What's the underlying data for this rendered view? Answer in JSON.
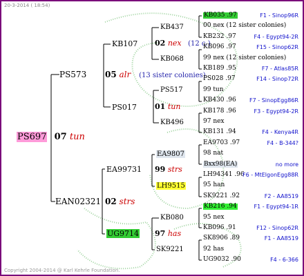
{
  "header": {
    "timestamp": "20-3-2014 ( 18:54)"
  },
  "footer": {
    "copyright": "Copyright 2004-2014 @ Karl Kehrle Foundation."
  },
  "root": {
    "id": "PS697",
    "mark": "07",
    "tag": "tun"
  },
  "g1": [
    {
      "id": "PS573"
    },
    {
      "id": "EAN02321",
      "mark": "02",
      "tag": "strs"
    }
  ],
  "g1_marks": {
    "ps573": {
      "mark": "05",
      "tag": "alr",
      "note": "(13 sister colonies)"
    }
  },
  "g2": {
    "kb107": "KB107",
    "ps017": "PS017",
    "ea99731": "EA99731",
    "ug9714": "UG9714",
    "ps017_mark": "01",
    "ps017_tag": "tun",
    "ea99731_mark": "99",
    "ea99731_tag": "strs",
    "ug9714_mark": "97",
    "ug9714_tag": "has",
    "kb107_mark": "02",
    "kb107_tag": "nex",
    "kb107_note": "(12 c.)"
  },
  "g3": {
    "kb437": "KB437",
    "kb068": "KB068",
    "ps517": "PS517",
    "kb496": "KB496",
    "ea9807": "EA9807",
    "lh9515": "LH9515",
    "kb080": "KB080",
    "sk9221": "SK9221",
    "ps517_mark": "99",
    "ps517_tag": "tun",
    "kb496_mark": "97",
    "kb496_tag": "nex",
    "ea9807_mark": "98",
    "ea9807_tag": "nat",
    "lh9515_mark": "95",
    "lh9515_tag": "han",
    "kb080_mark": "95",
    "kb080_tag": "nex",
    "sk9221_mark": "92",
    "sk9221_tag": "has"
  },
  "g4": [
    {
      "left": "KB035 .97",
      "right": "F1 - Sinop96R"
    },
    {
      "left": "00 nex (12 sister colonies)",
      "right": ""
    },
    {
      "left": "KB232 .97",
      "right": "F4 - Egypt94-2R"
    },
    {
      "left": "KB096 .97",
      "right": "F15 - Sinop62R"
    },
    {
      "left": "99 nex (12 sister colonies)",
      "right": ""
    },
    {
      "left": "KB189 .95",
      "right": "F7 - Atlas85R"
    },
    {
      "left": "PS028 .97",
      "right": "F14 - Sinop72R"
    },
    {
      "left": "99 tun",
      "right": ""
    },
    {
      "left": "KB430 .96",
      "right": "F7 - SinopEgg86R"
    },
    {
      "left": "KB178 .96",
      "right": "F3 - Egypt94-2R"
    },
    {
      "left": "97 nex",
      "right": ""
    },
    {
      "left": "KB131 .94",
      "right": "F4 - Kenya4R"
    },
    {
      "left": "EA9703 .97",
      "right": "F4 - B-344?"
    },
    {
      "left": "98 nat",
      "right": ""
    },
    {
      "left": "Bxx98(EA)",
      "right": "no more"
    },
    {
      "left": "LH94341 .96",
      "right": "F6 - MtElgonEgg88R"
    },
    {
      "left": "95 han",
      "right": ""
    },
    {
      "left": "SK9221 .92",
      "right": "F2 - AA8519"
    },
    {
      "left": "KB216 .94",
      "right": "F1 - Egypt94-1R"
    },
    {
      "left": "95 nex",
      "right": ""
    },
    {
      "left": "KB096 .91",
      "right": "F12 - Sinop62R"
    },
    {
      "left": "SK8906 .89",
      "right": "F1 - AA8519"
    },
    {
      "left": "92 has",
      "right": ""
    },
    {
      "left": "UG9032 .90",
      "right": "F4 - 6-366"
    }
  ],
  "colors": {
    "border": "#7a0a7a",
    "pink": "#ff9bd9",
    "yellow": "#ffff33",
    "green": "#33cc33",
    "red": "#cc0000",
    "blue": "#1010cc"
  }
}
